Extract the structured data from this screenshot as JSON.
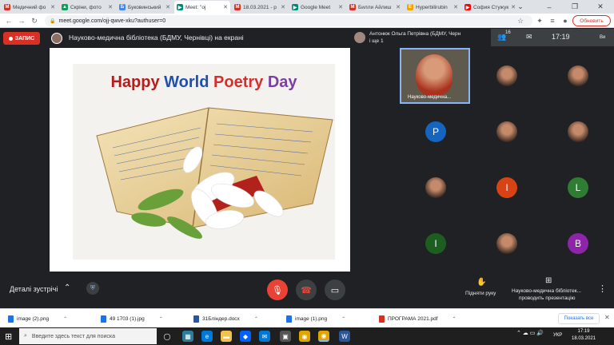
{
  "browser": {
    "tabs": [
      {
        "label": "Медичний фо",
        "color": "#d93025",
        "icon": "M"
      },
      {
        "label": "Скріни, фото",
        "color": "#0f9d58",
        "icon": "▲"
      },
      {
        "label": "Буковинський",
        "color": "#4285f4",
        "icon": "Б"
      },
      {
        "label": "Meet: \"oj",
        "color": "#00897b",
        "icon": "▶",
        "active": true
      },
      {
        "label": "18.03.2021 - p",
        "color": "#d93025",
        "icon": "M"
      },
      {
        "label": "Google Meet",
        "color": "#00897b",
        "icon": "▶"
      },
      {
        "label": "Билли Айлиш",
        "color": "#d93025",
        "icon": "M"
      },
      {
        "label": "Hyperbilirubin",
        "color": "#f4a300",
        "icon": "E"
      },
      {
        "label": "София Стужук",
        "color": "#ff0000",
        "icon": "▶"
      }
    ],
    "url": "meet.google.com/ojj-qwve-xku?authuser=0",
    "update_label": "Обновить"
  },
  "meet": {
    "recording_label": "ЗАПИС",
    "presenter_title": "Науково-медична бібліотека (БДМУ, Чернівці) на екрані",
    "pinned_name": "Антонюк Ольга Петрівна (БДМУ, Черн",
    "pinned_more": "і ще 1",
    "people_count": "16",
    "clock": "17:19",
    "self_label": "Ви",
    "slide_title_parts": [
      {
        "text": "Happy ",
        "color": "#b71c1c"
      },
      {
        "text": "World ",
        "color": "#1e4fb5"
      },
      {
        "text": "Poetry ",
        "color": "#d32f2f"
      },
      {
        "text": "Day",
        "color": "#7b3fa3"
      }
    ],
    "main_tile_name": "Науково-медична...",
    "participants": [
      {
        "type": "photo"
      },
      {
        "type": "photo"
      },
      {
        "letter": "P",
        "color": "#1565c0"
      },
      {
        "type": "photo"
      },
      {
        "type": "photo"
      },
      {
        "type": "photo"
      },
      {
        "letter": "I",
        "color": "#d84315"
      },
      {
        "letter": "L",
        "color": "#2e7d32"
      },
      {
        "letter": "I",
        "color": "#1b5e20"
      },
      {
        "type": "photo"
      },
      {
        "letter": "B",
        "color": "#8e24aa"
      }
    ],
    "details_label": "Деталі зустрічі",
    "raise_hand_label": "Підняти руку",
    "present_label_1": "Науково-медична бібліотек...",
    "present_label_2": "проводить презентацію"
  },
  "downloads": {
    "items": [
      {
        "name": "image (2).png",
        "color": "#1a73e8"
      },
      {
        "name": "49 1703 (1).jpg",
        "color": "#1a73e8"
      },
      {
        "name": "31Бліндер.docx",
        "color": "#2b579a"
      },
      {
        "name": "image (1).png",
        "color": "#1a73e8"
      },
      {
        "name": "ПРОГРАМА 2021.pdf",
        "color": "#d93025"
      }
    ],
    "show_all_label": "Показать все"
  },
  "taskbar": {
    "search_placeholder": "Введите здесь текст для поиска",
    "language": "УКР",
    "time": "17:19",
    "date": "18.03.2021"
  }
}
